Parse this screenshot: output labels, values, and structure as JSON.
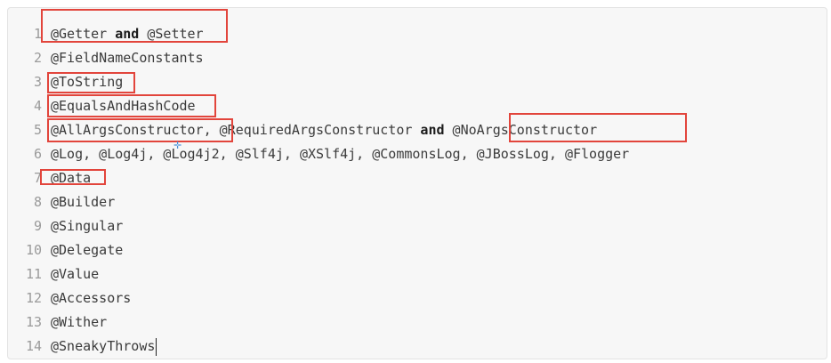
{
  "lines": [
    {
      "num": "1",
      "parts": [
        {
          "t": "@Getter"
        },
        {
          "t": " and ",
          "kw": true
        },
        {
          "t": "@Setter"
        }
      ]
    },
    {
      "num": "2",
      "parts": [
        {
          "t": "@FieldNameConstants"
        }
      ]
    },
    {
      "num": "3",
      "parts": [
        {
          "t": "@ToString"
        }
      ]
    },
    {
      "num": "4",
      "parts": [
        {
          "t": "@EqualsAndHashCode"
        }
      ]
    },
    {
      "num": "5",
      "parts": [
        {
          "t": "@AllArgsConstructor, @RequiredArgsConstructor"
        },
        {
          "t": " and ",
          "kw": true
        },
        {
          "t": "@NoArgsConstructor"
        }
      ]
    },
    {
      "num": "6",
      "parts": [
        {
          "t": "@Log, @Log4j, @Log4j2, @Slf4j, @XSlf4j, @CommonsLog, @JBossLog, @Flogger"
        }
      ]
    },
    {
      "num": "7",
      "parts": [
        {
          "t": "@Data"
        }
      ]
    },
    {
      "num": "8",
      "parts": [
        {
          "t": "@Builder"
        }
      ]
    },
    {
      "num": "9",
      "parts": [
        {
          "t": "@Singular"
        }
      ]
    },
    {
      "num": "10",
      "parts": [
        {
          "t": "@Delegate"
        }
      ]
    },
    {
      "num": "11",
      "parts": [
        {
          "t": "@Value"
        }
      ]
    },
    {
      "num": "12",
      "parts": [
        {
          "t": "@Accessors"
        }
      ]
    },
    {
      "num": "13",
      "parts": [
        {
          "t": "@Wither"
        }
      ]
    },
    {
      "num": "14",
      "parts": [
        {
          "t": "@SneakyThrows"
        }
      ]
    }
  ],
  "highlight_color": "#e2453c",
  "cursor_icon": "crosshair-icon",
  "text_cursor_line": "14"
}
